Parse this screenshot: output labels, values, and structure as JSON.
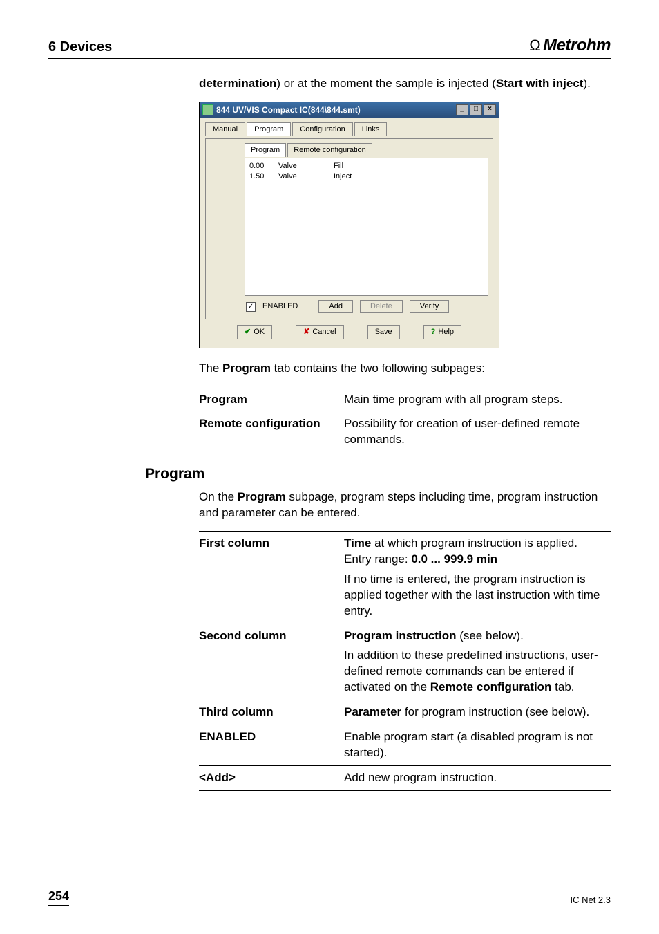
{
  "header": {
    "left": "6  Devices",
    "brand": "Metrohm"
  },
  "intro": {
    "prefix": "determination",
    "mid": ") or at the moment the sample is injected (",
    "suffix_bold": "Start with inject",
    "end": ")."
  },
  "win": {
    "title": "844 UV/VIS Compact IC(844\\844.smt)",
    "tabs": {
      "t0": "Manual",
      "t1": "Program",
      "t2": "Configuration",
      "t3": "Links"
    },
    "subtabs": {
      "s0": "Program",
      "s1": "Remote configuration"
    },
    "rows": {
      "r0": {
        "c0": "0.00",
        "c1": "Valve",
        "c2": "Fill"
      },
      "r1": {
        "c0": "1.50",
        "c1": "Valve",
        "c2": "Inject"
      }
    },
    "enabled_label": "ENABLED",
    "btns": {
      "add": "Add",
      "delete": "Delete",
      "verify": "Verify"
    },
    "bottom": {
      "ok": "OK",
      "cancel": "Cancel",
      "save": "Save",
      "help": "Help"
    },
    "winbtns": {
      "min": "_",
      "max": "□",
      "close": "×"
    }
  },
  "after_shot": {
    "p1_a": "The ",
    "p1_b": "Program",
    "p1_c": " tab contains the two following subpages:"
  },
  "defs1": {
    "r0": {
      "label": "Program",
      "desc": "Main time program with all program steps."
    },
    "r1": {
      "label": "Remote configuration",
      "desc": "Possibility for creation of user-defined remote commands."
    }
  },
  "section": {
    "title": "Program",
    "intro_a": "On the ",
    "intro_b": "Program",
    "intro_c": " subpage, program steps including time, program instruction and parameter can be entered."
  },
  "defs2": {
    "r0": {
      "label": "First column",
      "b1": "Time",
      "t1": " at which program instruction is applied.",
      "t2a": "Entry range: ",
      "t2b": "0.0 ... 999.9 min",
      "t3": "If no time is entered, the program instruction is applied together with the last instruction with time entry."
    },
    "r1": {
      "label": "Second column",
      "b1": "Program instruction",
      "t1": " (see below).",
      "t2a": "In addition to these predefined instructions, user-defined remote commands can be entered if activated on the ",
      "t2b": "Remote configuration",
      "t2c": " tab."
    },
    "r2": {
      "label": "Third column",
      "b1": "Parameter",
      "t1": " for program instruction (see below)."
    },
    "r3": {
      "label": "ENABLED",
      "t1": "Enable program start (a disabled program is not started)."
    },
    "r4": {
      "label": "<Add>",
      "t1": "Add new program instruction."
    }
  },
  "footer": {
    "page": "254",
    "docid": "IC Net 2.3"
  }
}
